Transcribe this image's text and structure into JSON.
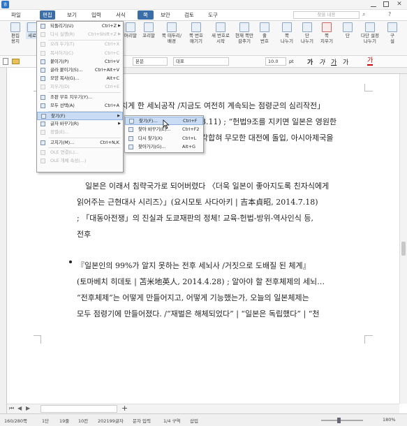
{
  "menubar": {
    "items": [
      "파일",
      "편집",
      "보기",
      "입력",
      "서식",
      "쪽",
      "보안",
      "검토",
      "도구"
    ],
    "selected": "편집",
    "search_placeholder": "찾을 내용"
  },
  "ribbon": {
    "left": [
      {
        "label": "편집\n용지"
      },
      {
        "label": "세로"
      }
    ],
    "right": [
      {
        "label": "머리말"
      },
      {
        "label": "꼬리말"
      },
      {
        "label": "쪽 테두리/\n배경"
      },
      {
        "label": "쪽 번호\n매기기"
      },
      {
        "label": "새 번호로\n시작"
      },
      {
        "label": "현재 쪽만\n감추기"
      },
      {
        "label": "줄\n번호"
      },
      {
        "label": "쪽\n나누기"
      },
      {
        "label": "단\n나누기"
      },
      {
        "label": "쪽\n지우기"
      },
      {
        "label": "단"
      },
      {
        "label": "다단 설정\n나누기"
      },
      {
        "label": "구\n설"
      }
    ]
  },
  "formatbar": {
    "style": "본문",
    "font": "대표",
    "size": "10.0",
    "unit": "pt"
  },
  "edit_menu": {
    "items": [
      {
        "label": "되돌리기(U)",
        "shortcut": "Ctrl+Z",
        "enabled": true,
        "submenu": true
      },
      {
        "label": "다시 실행(R)",
        "shortcut": "Ctrl+Shift+Z",
        "enabled": false,
        "submenu": true
      },
      {
        "label": "오려 두기(T)",
        "shortcut": "Ctrl+X",
        "enabled": false
      },
      {
        "label": "복사하기(C)",
        "shortcut": "Ctrl+C",
        "enabled": false
      },
      {
        "label": "붙이기(P)",
        "shortcut": "Ctrl+V",
        "enabled": true
      },
      {
        "label": "골라 붙이기(S)...",
        "shortcut": "Ctrl+Alt+V",
        "enabled": true
      },
      {
        "label": "모양 복사(G)...",
        "shortcut": "Alt+C",
        "enabled": true
      },
      {
        "label": "지우기(D)",
        "shortcut": "Ctrl+E",
        "enabled": false
      },
      {
        "label": "조판 부호 지우기(Y)...",
        "shortcut": "",
        "enabled": true
      },
      {
        "label": "모두 선택(A)",
        "shortcut": "Ctrl+A",
        "enabled": true
      },
      {
        "label": "찾기(F)",
        "shortcut": "",
        "enabled": true,
        "submenu": true,
        "highlighted": true
      },
      {
        "label": "글자 바꾸기(R)",
        "shortcut": "",
        "enabled": true,
        "submenu": true
      },
      {
        "label": "정렬(E)...",
        "shortcut": "",
        "enabled": false
      },
      {
        "label": "고치기(M)...",
        "shortcut": "Ctrl+N,K",
        "enabled": true
      },
      {
        "label": "OLE 연결(L)...",
        "shortcut": "",
        "enabled": false
      },
      {
        "label": "OLE 개체 속성(...)",
        "shortcut": "",
        "enabled": false
      }
    ]
  },
  "find_submenu": {
    "items": [
      {
        "label": "찾기(F)...",
        "shortcut": "Ctrl+F",
        "highlighted": true
      },
      {
        "label": "찾아 바꾸기(E)...",
        "shortcut": "Ctrl+F2"
      },
      {
        "label": "다시 찾기(X)",
        "shortcut": "Ctrl+L"
      },
      {
        "label": "찾아가기(G)...",
        "shortcut": "Alt+G"
      }
    ]
  },
  "document": {
    "lines": [
      "치게 한 세뇌공작 /지금도 여전히 계속되는 점령군의 심리작전」",
      "3.11) ; “헌법9조를 지키면 일본은 영원한",
      "각합혀 무모한 대전에 돌입, 아시아제국을",
      "일본은 이래서 침략국가로 되어버렸다 〈더욱 일본이 좋아지도록 친자식에게",
      "읽어주는 근현대사 시리즈〉」(요시모토 사다아키 | 吉本貞昭, 2014.7.18)",
      "; 「대동아전쟁」의 진실과 도쿄재판의 정체! 교육-헌법-방위-역사인식 등,",
      "전후",
      "『일본인의 99%가 알지 못하는 전후 세뇌사 /거짓으로 도배질 된 체계』",
      "(토마베치 히데토 | 苫米地英人, 2014.4.28) ; 알아야 할 전후체제의 세뇌…",
      "“전후체제”는 어떻게 만들어지고, 어떻게 기능했는가, 오늘의 일본체제는",
      "모두 점령기에 만들어졌다. /“재벌은 해체되었다” | “일본은 독립했다” | “천"
    ]
  },
  "tabs": {
    "add": "+"
  },
  "status": {
    "page": "160/280쪽",
    "section": "1단",
    "line": "19줄",
    "col": "10칸",
    "chars": "202199글자",
    "mode": "문자 입력",
    "area": "1/4 구역",
    "insert": "삽입",
    "zoom": "180%"
  },
  "colors": {
    "accent": "#3b6ea8",
    "highlight": "#c9dcf3"
  }
}
